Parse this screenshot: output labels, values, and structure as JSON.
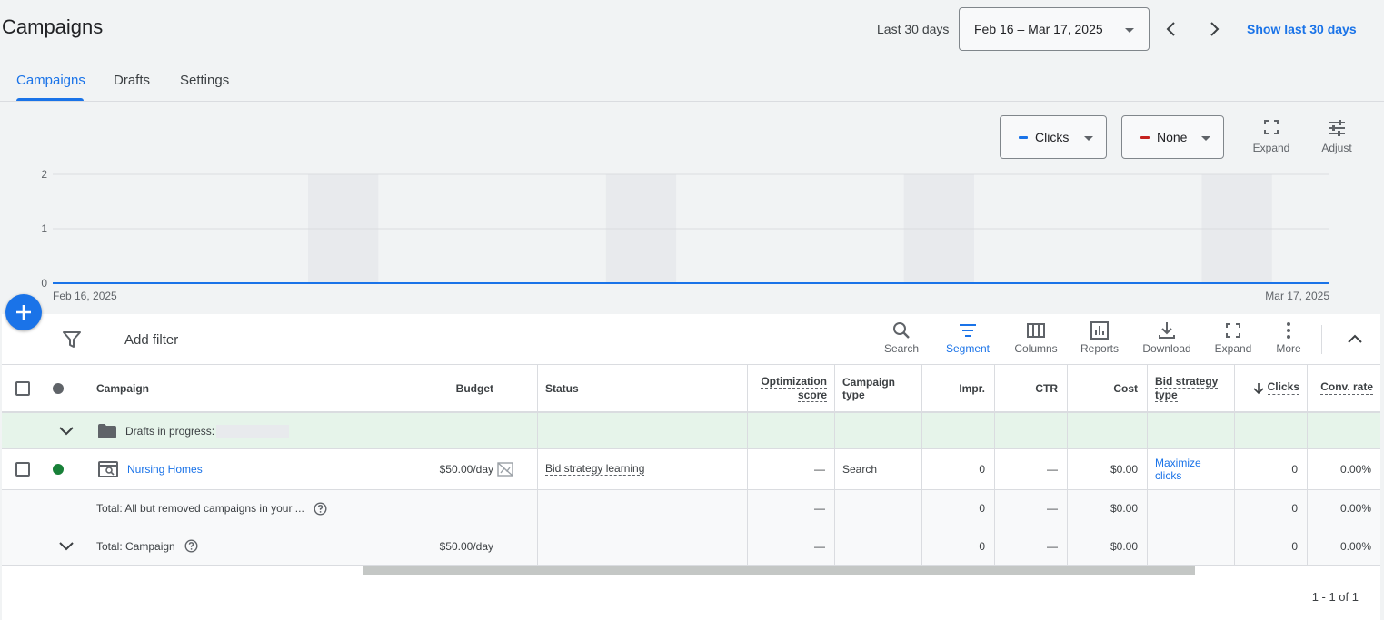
{
  "header": {
    "title": "Campaigns",
    "range_label": "Last 30 days",
    "date_range": "Feb 16 – Mar 17, 2025",
    "show_last": "Show last 30 days"
  },
  "tabs": [
    {
      "label": "Campaigns",
      "active": true
    },
    {
      "label": "Drafts",
      "active": false
    },
    {
      "label": "Settings",
      "active": false
    }
  ],
  "chart_controls": {
    "metric1": {
      "label": "Clicks",
      "color": "#1a73e8"
    },
    "metric2": {
      "label": "None",
      "color": "#c5221f"
    },
    "expand": "Expand",
    "adjust": "Adjust"
  },
  "chart_data": {
    "type": "line",
    "x_start_label": "Feb 16, 2025",
    "x_end_label": "Mar 17, 2025",
    "y_ticks": [
      "2",
      "1",
      "0"
    ],
    "ylim": [
      0,
      2
    ],
    "series": [
      {
        "name": "Clicks",
        "values": [
          0,
          0,
          0,
          0,
          0,
          0,
          0,
          0,
          0,
          0,
          0,
          0,
          0,
          0,
          0,
          0,
          0,
          0,
          0,
          0,
          0,
          0,
          0,
          0,
          0,
          0,
          0,
          0,
          0,
          0
        ]
      }
    ],
    "grid": true
  },
  "toolbar": {
    "add_filter": "Add filter",
    "buttons": [
      {
        "label": "Search",
        "icon": "search-icon"
      },
      {
        "label": "Segment",
        "icon": "segment-icon"
      },
      {
        "label": "Columns",
        "icon": "columns-icon"
      },
      {
        "label": "Reports",
        "icon": "reports-icon"
      },
      {
        "label": "Download",
        "icon": "download-icon"
      },
      {
        "label": "Expand",
        "icon": "expand-icon"
      },
      {
        "label": "More",
        "icon": "more-icon"
      }
    ]
  },
  "table": {
    "headers": {
      "campaign": "Campaign",
      "budget": "Budget",
      "status": "Status",
      "opt_score_1": "Optimization",
      "opt_score_2": "score",
      "campaign_type_1": "Campaign",
      "campaign_type_2": "type",
      "impr": "Impr.",
      "ctr": "CTR",
      "cost": "Cost",
      "bid_1": "Bid strategy",
      "bid_2": "type",
      "clicks": "Clicks",
      "conv_rate": "Conv. rate"
    },
    "drafts_row": {
      "label": "Drafts in progress:"
    },
    "campaign_row": {
      "name": "Nursing Homes",
      "budget": "$50.00/day",
      "status": "Bid strategy learning",
      "opt_score": "—",
      "type": "Search",
      "impr": "0",
      "ctr": "—",
      "cost": "$0.00",
      "bid_1": "Maximize",
      "bid_2": "clicks",
      "clicks": "0",
      "conv_rate": "0.00%",
      "status_color": "#188038"
    },
    "total_all_row": {
      "label": "Total: All but removed campaigns in your ...",
      "opt_score": "—",
      "impr": "0",
      "ctr": "—",
      "cost": "$0.00",
      "clicks": "0",
      "conv_rate": "0.00%"
    },
    "total_campaign_row": {
      "label": "Total: Campaign",
      "budget": "$50.00/day",
      "opt_score": "—",
      "impr": "0",
      "ctr": "—",
      "cost": "$0.00",
      "clicks": "0",
      "conv_rate": "0.00%"
    }
  },
  "pagination": "1 - 1 of 1"
}
